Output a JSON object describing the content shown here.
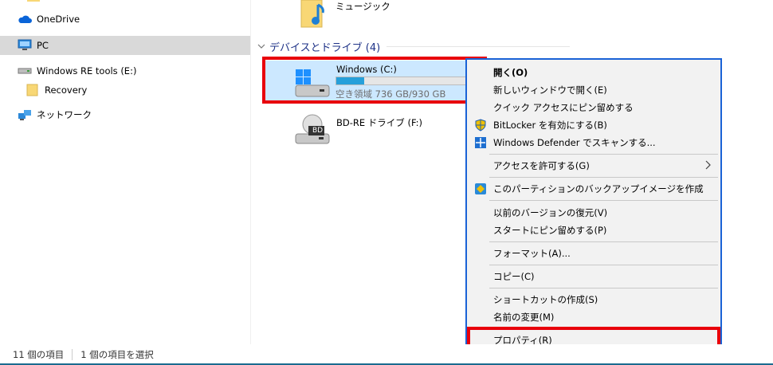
{
  "nav": {
    "items": [
      {
        "label": "OneDrive"
      },
      {
        "label": "PC"
      },
      {
        "label": "Windows RE tools (E:)"
      },
      {
        "label": "Recovery"
      },
      {
        "label": "ネットワーク"
      }
    ]
  },
  "content": {
    "top_item": "ミュージック",
    "section_title": "デバイスとドライブ (4)",
    "drives": [
      {
        "name": "Windows (C:)",
        "free": "空き領域 736 GB/930 GB",
        "used_fraction": 0.21
      },
      {
        "name": "BD-RE ドライブ (F:)",
        "icon_badge": "BD"
      }
    ]
  },
  "menu": {
    "items": [
      {
        "label": "開く(O)"
      },
      {
        "label": "新しいウィンドウで開く(E)"
      },
      {
        "label": "クイック アクセスにピン留めする"
      },
      {
        "label": "BitLocker を有効にする(B)"
      },
      {
        "label": "Windows Defender でスキャンする..."
      },
      {
        "label": "アクセスを許可する(G)"
      },
      {
        "label": "このパーティションのバックアップイメージを作成"
      },
      {
        "label": "以前のバージョンの復元(V)"
      },
      {
        "label": "スタートにピン留めする(P)"
      },
      {
        "label": "フォーマット(A)..."
      },
      {
        "label": "コピー(C)"
      },
      {
        "label": "ショートカットの作成(S)"
      },
      {
        "label": "名前の変更(M)"
      },
      {
        "label": "プロパティ(R)"
      }
    ]
  },
  "status": {
    "count": "11 個の項目",
    "selected": "1 個の項目を選択"
  },
  "colors": {
    "highlight": "#e8000b",
    "menu_border": "#1a62d6",
    "selection": "#cce8ff",
    "progress": "#26a0da"
  }
}
